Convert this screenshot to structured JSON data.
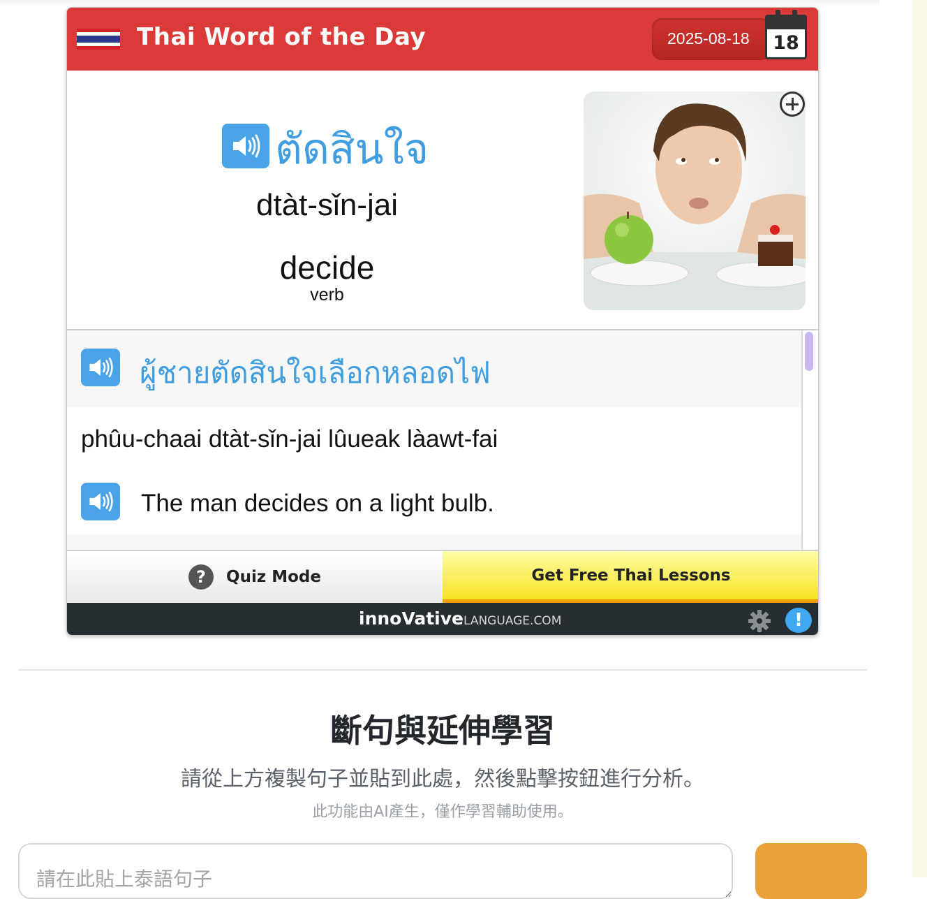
{
  "widget": {
    "title": "Thai Word of the Day",
    "date": "2025-08-18",
    "calendar_day": "18",
    "word": {
      "thai": "ตัดสินใจ",
      "romanization": "dtàt-sǐn-jai",
      "english": "decide",
      "part_of_speech": "verb"
    },
    "example": {
      "thai": "ผู้ชายตัดสินใจเลือกหลอดไฟ",
      "romanization": "phûu-chaai dtàt-sǐn-jai lûueak làawt-fai",
      "english": "The man decides on a light bulb."
    },
    "buttons": {
      "quiz_label": "Quiz Mode",
      "lessons_label": "Get Free Thai Lessons"
    },
    "footer": {
      "brand_main": "innoVative",
      "brand_suffix": "LANGUAGE.COM"
    },
    "colors": {
      "header_red": "#da3b38",
      "accent_blue": "#3f9de0",
      "lessons_yellow": "#f5e321"
    }
  },
  "analysis": {
    "title": "斷句與延伸學習",
    "subtitle": "請從上方複製句子並貼到此處，然後點擊按鈕進行分析。",
    "note": "此功能由AI產生，僅作學習輔助使用。",
    "input_placeholder": "請在此貼上泰語句子"
  }
}
